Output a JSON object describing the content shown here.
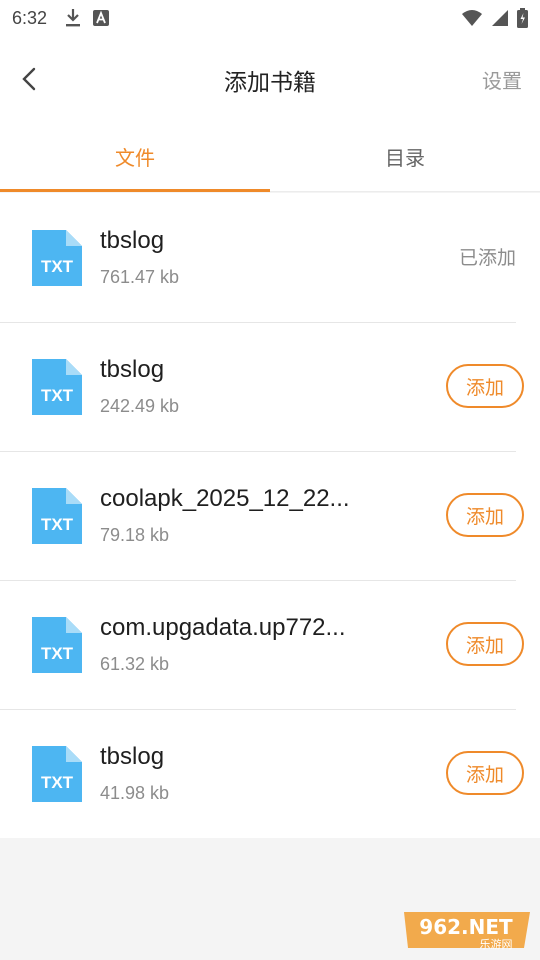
{
  "status_bar": {
    "time": "6:32",
    "icons": [
      "download-icon",
      "text-a-icon",
      "wifi-icon",
      "signal-icon",
      "battery-icon"
    ]
  },
  "app_bar": {
    "back_icon": "chevron-left-icon",
    "title": "添加书籍",
    "settings_label": "设置"
  },
  "tabs": [
    {
      "label": "文件",
      "active": true
    },
    {
      "label": "目录",
      "active": false
    }
  ],
  "files": [
    {
      "name": "tbslog",
      "size": "761.47 kb",
      "status": "已添加"
    },
    {
      "name": "tbslog",
      "size": "242.49 kb",
      "action": "添加"
    },
    {
      "name": "coolapk_2025_12_22...",
      "size": "79.18 kb",
      "action": "添加"
    },
    {
      "name": "com.upgadata.up772...",
      "size": "61.32 kb",
      "action": "添加"
    },
    {
      "name": "tbslog",
      "size": "41.98 kb",
      "action": "添加"
    }
  ],
  "file_icon_label": "TXT",
  "colors": {
    "accent": "#ef8a2a",
    "file_icon": "#4db6f2",
    "background": "#f4f4f4"
  },
  "watermark": {
    "brand": "962.NET",
    "sub": "乐游网"
  }
}
